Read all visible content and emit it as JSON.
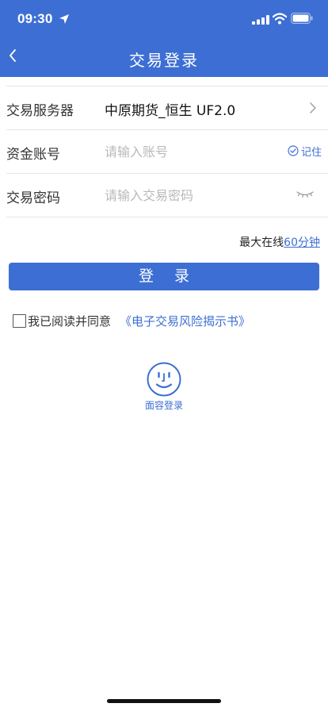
{
  "status_bar": {
    "time": "09:30"
  },
  "nav": {
    "title": "交易登录"
  },
  "form": {
    "server": {
      "label": "交易服务器",
      "value": "中原期货_恒生 UF2.0"
    },
    "account": {
      "label": "资金账号",
      "placeholder": "请输入账号",
      "remember_label": "记住"
    },
    "password": {
      "label": "交易密码",
      "placeholder": "请输入交易密码"
    }
  },
  "online": {
    "prefix": "最大在线",
    "duration": "60分钟"
  },
  "login_button": "登 录",
  "agreement": {
    "text": "我已阅读并同意",
    "link": "《电子交易风险揭示书》",
    "checked": false
  },
  "face_login": {
    "label": "面容登录"
  },
  "colors": {
    "accent": "#3d6ed4",
    "text": "#222222",
    "placeholder": "#b9b9b9",
    "divider": "#e6e6e6"
  },
  "icons": [
    "location-arrow-icon",
    "signal-icon",
    "wifi-icon",
    "battery-icon",
    "back-chevron-icon",
    "chevron-right-icon",
    "check-circle-icon",
    "eye-closed-icon",
    "face-id-icon"
  ]
}
